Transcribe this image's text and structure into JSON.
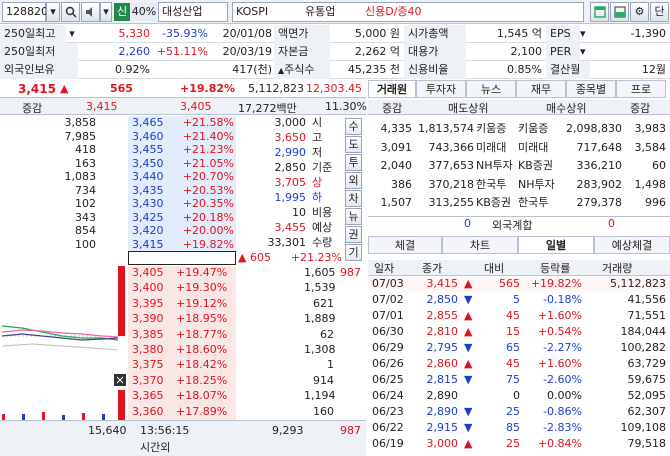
{
  "toolbar": {
    "code": "128820",
    "sin_label": "신",
    "ratio": "40%",
    "company": "대성산업",
    "market": "KOSPI",
    "sector": "유통업",
    "credit": "신용D/증40",
    "btn_dan": "단"
  },
  "info": {
    "high250_label": "250일최고",
    "high250_price": "5,330",
    "high250_pct": "-35.93%",
    "high250_date": "20/01/08",
    "low250_label": "250일최저",
    "low250_price": "2,260",
    "low250_pct": "+51.11%",
    "low250_date": "20/03/19",
    "foreign_label": "외국인보유",
    "foreign_pct": "0.92%",
    "foreign_qty": "417(천)",
    "face_label": "액면가",
    "face_val": "5,000 원",
    "capital_label": "자본금",
    "capital_val": "2,262 억",
    "shares_label": "주식수",
    "shares_val": "45,235 천",
    "mcap_label": "시가총액",
    "mcap_val": "1,545 억",
    "loan_label": "대용가",
    "loan_val": "2,100",
    "credit_label": "신용비율",
    "credit_val": "0.85%",
    "eps_label": "EPS",
    "eps_val": "-1,390",
    "per_label": "PER",
    "per_val": "",
    "settle_label": "결산월",
    "settle_val": "12월"
  },
  "price": {
    "current": "3,415",
    "arrow": "▲",
    "change": "565",
    "pct": "+19.82%",
    "volume": "5,112,823",
    "prev_vol": "12,303.45"
  },
  "hoga_head": {
    "label": "증감",
    "p1": "3,415",
    "p2": "3,405",
    "amount": "17,272백만",
    "rate": "11.30%"
  },
  "ask": [
    {
      "qty": "3,858",
      "price": "3,465",
      "pct": "+21.58%"
    },
    {
      "qty": "7,985",
      "price": "3,460",
      "pct": "+21.40%"
    },
    {
      "qty": "418",
      "price": "3,455",
      "pct": "+21.23%"
    },
    {
      "qty": "163",
      "price": "3,450",
      "pct": "+21.05%"
    },
    {
      "qty": "1,083",
      "price": "3,440",
      "pct": "+20.70%"
    },
    {
      "qty": "734",
      "price": "3,435",
      "pct": "+20.53%"
    },
    {
      "qty": "102",
      "price": "3,430",
      "pct": "+20.35%"
    },
    {
      "qty": "343",
      "price": "3,425",
      "pct": "+20.18%"
    },
    {
      "qty": "854",
      "price": "3,420",
      "pct": "+20.00%"
    },
    {
      "qty": "100",
      "price": "3,415",
      "pct": "+19.82%"
    }
  ],
  "bid": [
    {
      "qty": "1,605",
      "price": "3,405",
      "pct": "+19.47%"
    },
    {
      "qty": "1,539",
      "price": "3,400",
      "pct": "+19.30%"
    },
    {
      "qty": "621",
      "price": "3,395",
      "pct": "+19.12%"
    },
    {
      "qty": "1,889",
      "price": "3,390",
      "pct": "+18.95%"
    },
    {
      "qty": "62",
      "price": "3,385",
      "pct": "+18.77%"
    },
    {
      "qty": "1,308",
      "price": "3,380",
      "pct": "+18.60%"
    },
    {
      "qty": "1",
      "price": "3,375",
      "pct": "+18.42%"
    },
    {
      "qty": "914",
      "price": "3,370",
      "pct": "+18.25%"
    },
    {
      "qty": "1,194",
      "price": "3,365",
      "pct": "+18.07%"
    },
    {
      "qty": "160",
      "price": "3,360",
      "pct": "+17.89%"
    }
  ],
  "bid_side_count": "987",
  "summary": [
    {
      "val": "3,000",
      "lbl": "시"
    },
    {
      "val": "3,650",
      "lbl": "고"
    },
    {
      "val": "2,990",
      "lbl": "저"
    },
    {
      "val": "2,850",
      "lbl": "기준"
    },
    {
      "val": "3,705",
      "lbl": "상"
    },
    {
      "val": "1,995",
      "lbl": "하"
    },
    {
      "val": "10",
      "lbl": "비용"
    },
    {
      "val": "3,455",
      "lbl": "예상"
    },
    {
      "val": "33,301",
      "lbl": "수량"
    }
  ],
  "expect": {
    "arrow": "▲",
    "change": "605",
    "pct": "+21.23%"
  },
  "side_buttons": [
    "수",
    "도",
    "투",
    "외",
    "차",
    "뉴",
    "권",
    "기"
  ],
  "hoga_foot": {
    "ask_total": "15,640",
    "time": "13:56:15",
    "time_label": "시간외",
    "bid_total": "9,293",
    "count": "987"
  },
  "broker": {
    "tabs": [
      "거래원",
      "투자자",
      "뉴스",
      "재무",
      "종목별",
      "프로"
    ],
    "headers": [
      "증감",
      "매도상위",
      "매수상위",
      "증감"
    ],
    "rows": [
      {
        "chg1": "4,335",
        "sell_qty": "1,813,574",
        "sell_name": "키움증",
        "buy_name": "키움증",
        "buy_qty": "2,098,830",
        "chg2": "3,983"
      },
      {
        "chg1": "3,091",
        "sell_qty": "743,366",
        "sell_name": "미래대",
        "buy_name": "미래대",
        "buy_qty": "717,648",
        "chg2": "3,584"
      },
      {
        "chg1": "2,040",
        "sell_qty": "377,653",
        "sell_name": "NH투자",
        "buy_name": "KB증권",
        "buy_qty": "336,210",
        "chg2": "60"
      },
      {
        "chg1": "386",
        "sell_qty": "370,218",
        "sell_name": "한국투",
        "buy_name": "NH투자",
        "buy_qty": "283,902",
        "chg2": "1,498"
      },
      {
        "chg1": "1,507",
        "sell_qty": "313,255",
        "sell_name": "KB증권",
        "buy_name": "한국투",
        "buy_qty": "279,378",
        "chg2": "996"
      }
    ],
    "foreign_left": "0",
    "foreign_label": "외국계합",
    "foreign_right": "0"
  },
  "daily": {
    "tabs": [
      "체결",
      "차트",
      "일별",
      "예상체결"
    ],
    "headers": [
      "일자",
      "종가",
      "대비",
      "등락률",
      "거래량"
    ],
    "rows": [
      {
        "date": "07/03",
        "close": "3,415",
        "dir": "up",
        "diff": "565",
        "rate": "+19.82%",
        "vol": "5,112,823"
      },
      {
        "date": "07/02",
        "close": "2,850",
        "dir": "down",
        "diff": "5",
        "rate": "-0.18%",
        "vol": "41,556"
      },
      {
        "date": "07/01",
        "close": "2,855",
        "dir": "up",
        "diff": "45",
        "rate": "+1.60%",
        "vol": "71,551"
      },
      {
        "date": "06/30",
        "close": "2,810",
        "dir": "up",
        "diff": "15",
        "rate": "+0.54%",
        "vol": "184,044"
      },
      {
        "date": "06/29",
        "close": "2,795",
        "dir": "down",
        "diff": "65",
        "rate": "-2.27%",
        "vol": "100,282"
      },
      {
        "date": "06/26",
        "close": "2,860",
        "dir": "up",
        "diff": "45",
        "rate": "+1.60%",
        "vol": "63,729"
      },
      {
        "date": "06/25",
        "close": "2,815",
        "dir": "down",
        "diff": "75",
        "rate": "-2.60%",
        "vol": "59,675"
      },
      {
        "date": "06/24",
        "close": "2,890",
        "dir": "none",
        "diff": "0",
        "rate": "0.00%",
        "vol": "52,095"
      },
      {
        "date": "06/23",
        "close": "2,890",
        "dir": "down",
        "diff": "25",
        "rate": "-0.86%",
        "vol": "62,307"
      },
      {
        "date": "06/22",
        "close": "2,915",
        "dir": "down",
        "diff": "85",
        "rate": "-2.83%",
        "vol": "109,108"
      },
      {
        "date": "06/19",
        "close": "3,000",
        "dir": "up",
        "diff": "25",
        "rate": "+0.84%",
        "vol": "79,518"
      }
    ]
  }
}
